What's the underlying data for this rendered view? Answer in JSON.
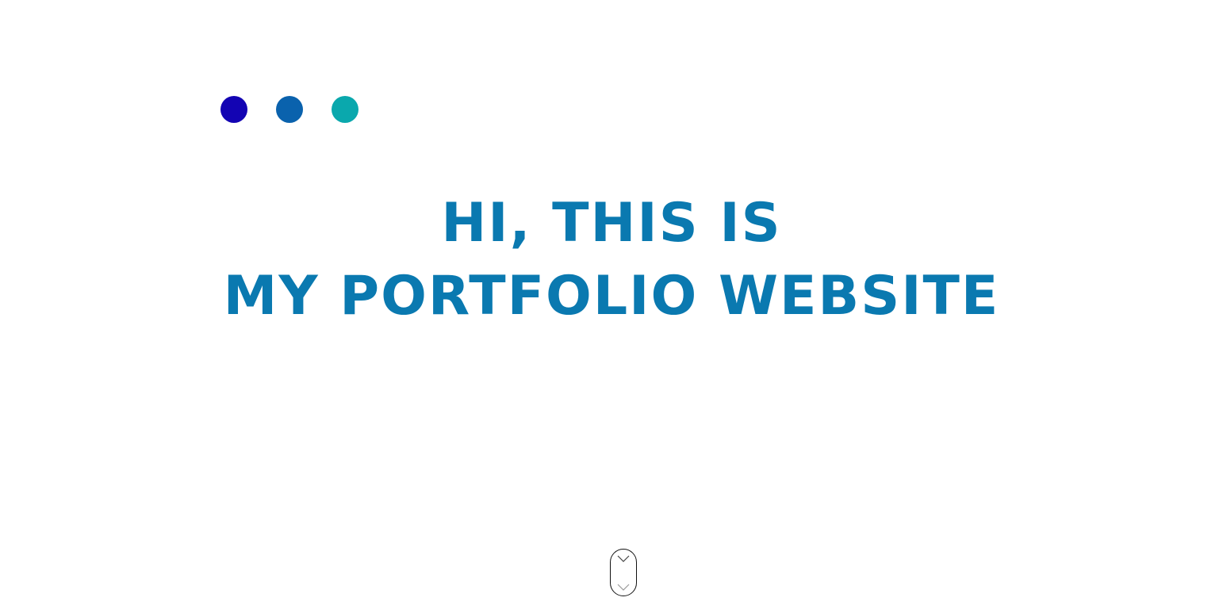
{
  "colors": {
    "dot_1": "#1304b3",
    "dot_2": "#0a62ad",
    "dot_3": "#0aa8ad",
    "hero_text": "#0a79b0",
    "background": "#ffffff"
  },
  "window_controls": [
    {
      "icon": "circle-dot-icon",
      "color": "#1304b3"
    },
    {
      "icon": "circle-dot-icon",
      "color": "#0a62ad"
    },
    {
      "icon": "circle-dot-icon",
      "color": "#0aa8ad"
    }
  ],
  "hero": {
    "line1": "HI, THIS IS",
    "line2": "MY PORTFOLIO WEBSITE"
  },
  "scroll_indicator": {
    "icon_top": "chevron-down-icon",
    "icon_bottom": "chevron-down-icon"
  }
}
